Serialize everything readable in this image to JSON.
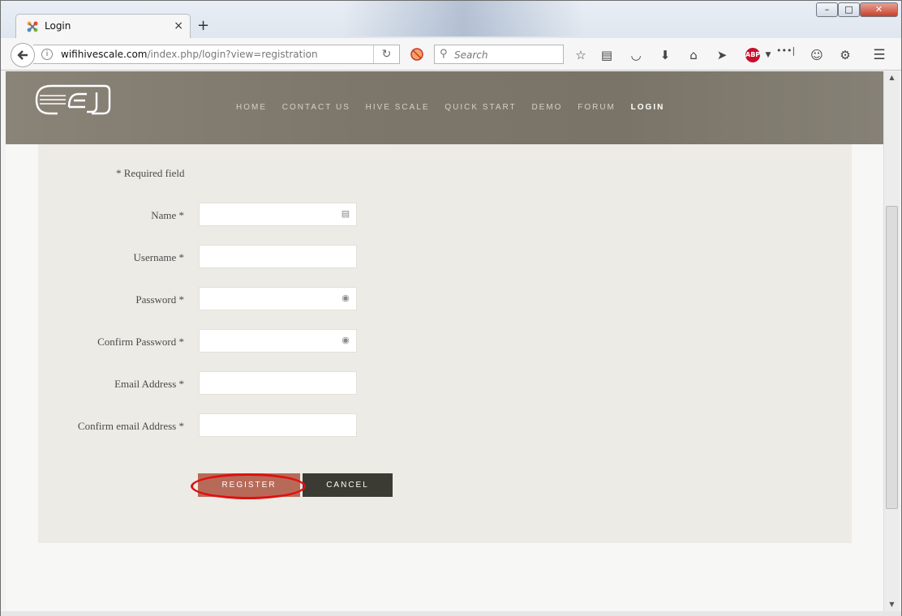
{
  "browser": {
    "tab_title": "Login",
    "tab_close": "×",
    "new_tab": "+",
    "url_host": "wifihivescale.com",
    "url_path": "/index.php/login?view=registration",
    "search_placeholder": "Search",
    "window_min": "–",
    "window_max": "□",
    "window_close": "✕",
    "abp_label": "ABP"
  },
  "site": {
    "nav": [
      "HOME",
      "CONTACT US",
      "HIVE SCALE",
      "QUICK START",
      "DEMO",
      "FORUM",
      "LOGIN"
    ],
    "active_nav": "LOGIN"
  },
  "form": {
    "required_note": "* Required field",
    "fields": [
      {
        "label": "Name *",
        "value": "",
        "icon": "contact-card-icon"
      },
      {
        "label": "Username *",
        "value": "",
        "icon": ""
      },
      {
        "label": "Password *",
        "value": "",
        "icon": "key-icon"
      },
      {
        "label": "Confirm Password *",
        "value": "",
        "icon": "key-icon"
      },
      {
        "label": "Email Address *",
        "value": "",
        "icon": ""
      },
      {
        "label": "Confirm email Address *",
        "value": "",
        "icon": ""
      }
    ],
    "register_label": "REGISTER",
    "cancel_label": "CANCEL"
  },
  "colors": {
    "header_bg": "#7d776b",
    "content_bg": "#edebe5",
    "register_bg": "#b86a58",
    "cancel_bg": "#3b3a33",
    "highlight_ring": "#e01010"
  }
}
